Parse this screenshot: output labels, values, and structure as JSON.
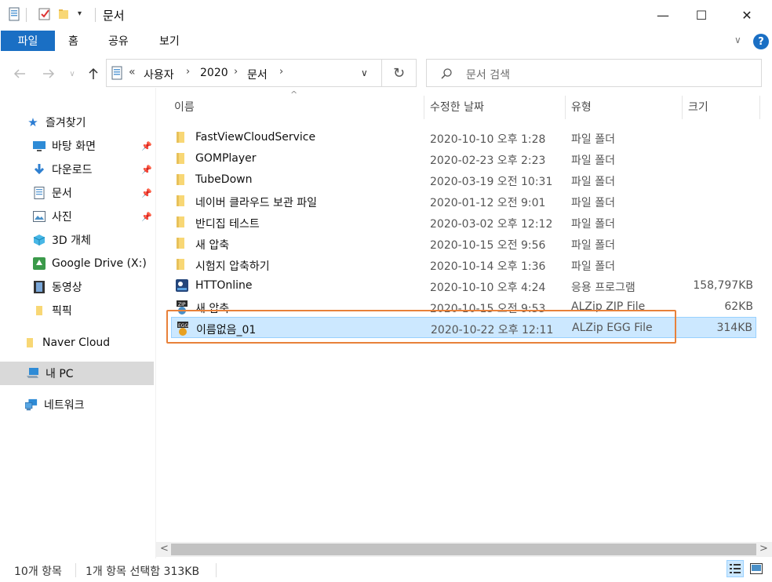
{
  "window": {
    "title": "문서",
    "minimize": "—",
    "maximize": "☐",
    "close": "✕"
  },
  "ribbon": {
    "file_tab": "파일",
    "tabs": [
      "홈",
      "공유",
      "보기"
    ],
    "collapse": "∨",
    "help": "?"
  },
  "address": {
    "overflow": "«",
    "crumbs": [
      "사용자",
      "2020",
      "문서"
    ],
    "separator": "›",
    "dropdown": "∨",
    "refresh": "↻"
  },
  "search": {
    "placeholder": "문서 검색"
  },
  "nav": {
    "quick_access": "즐겨찾기",
    "items": [
      {
        "label": "바탕 화면",
        "icon": "desktop-icon",
        "pinned": true
      },
      {
        "label": "다운로드",
        "icon": "download-icon",
        "pinned": true
      },
      {
        "label": "문서",
        "icon": "document-icon",
        "pinned": true
      },
      {
        "label": "사진",
        "icon": "pictures-icon",
        "pinned": true
      },
      {
        "label": "3D 개체",
        "icon": "3d-objects-icon",
        "pinned": false
      },
      {
        "label": "Google Drive (X:)",
        "icon": "google-drive-icon",
        "pinned": false
      },
      {
        "label": "동영상",
        "icon": "videos-icon",
        "pinned": false
      },
      {
        "label": "픽픽",
        "icon": "folder-icon",
        "pinned": false
      }
    ],
    "naver_cloud": "Naver Cloud",
    "this_pc": "내 PC",
    "network": "네트워크",
    "pin_glyph": "📌"
  },
  "columns": {
    "name": "이름",
    "date": "수정한 날짜",
    "type": "유형",
    "size": "크기",
    "sort_indicator": "^"
  },
  "files": [
    {
      "name": "FastViewCloudService",
      "date": "2020-10-10 오후 1:28",
      "type": "파일 폴더",
      "size": "",
      "icon": "folder"
    },
    {
      "name": "GOMPlayer",
      "date": "2020-02-23 오후 2:23",
      "type": "파일 폴더",
      "size": "",
      "icon": "folder"
    },
    {
      "name": "TubeDown",
      "date": "2020-03-19 오전 10:31",
      "type": "파일 폴더",
      "size": "",
      "icon": "folder"
    },
    {
      "name": "네이버 클라우드 보관 파일",
      "date": "2020-01-12 오전 9:01",
      "type": "파일 폴더",
      "size": "",
      "icon": "folder"
    },
    {
      "name": "반디집 테스트",
      "date": "2020-03-02 오후 12:12",
      "type": "파일 폴더",
      "size": "",
      "icon": "folder"
    },
    {
      "name": "새 압축",
      "date": "2020-10-15 오전 9:56",
      "type": "파일 폴더",
      "size": "",
      "icon": "folder"
    },
    {
      "name": "시험지 압축하기",
      "date": "2020-10-14 오후 1:36",
      "type": "파일 폴더",
      "size": "",
      "icon": "folder"
    },
    {
      "name": "HTTOnline",
      "date": "2020-10-10 오후 4:24",
      "type": "응용 프로그램",
      "size": "158,797KB",
      "icon": "app"
    },
    {
      "name": "새 압축",
      "date": "2020-10-15 오전 9:53",
      "type": "ALZip ZIP File",
      "size": "62KB",
      "icon": "zip"
    },
    {
      "name": "이름없음_01",
      "date": "2020-10-22 오후 12:11",
      "type": "ALZip EGG File",
      "size": "314KB",
      "icon": "egg"
    }
  ],
  "scroll": {
    "left": "<",
    "right": ">"
  },
  "status": {
    "count": "10개 항목",
    "selection": "1개 항목 선택함 313KB"
  },
  "colors": {
    "accent": "#1a6fc4",
    "selection": "#cce8ff",
    "highlight": "#e8813a"
  }
}
